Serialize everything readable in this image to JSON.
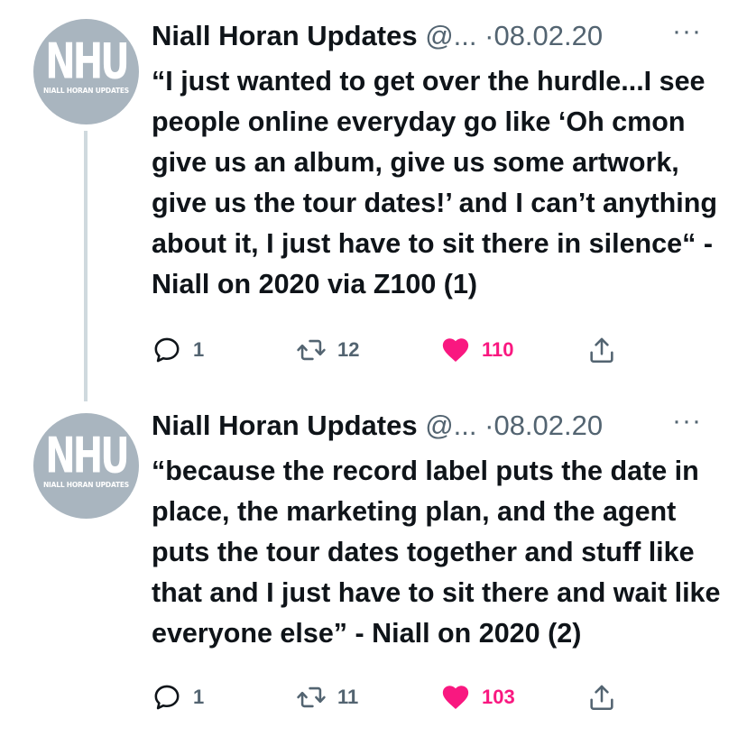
{
  "tweets": [
    {
      "avatar": {
        "logo": "NHU",
        "sub": "NIALL HORAN UPDATES"
      },
      "author_name": "Niall Horan Updates",
      "handle": "@...",
      "separator": "·",
      "date": "08.02.20",
      "more_label": "···",
      "text": "“I just wanted to get over the hurdle...I see people online everyday go like ‘Oh cmon give us an album, give us some artwork, give us the tour dates!’ and I can’t anything about it, I just have to sit there in silence“ - Niall on 2020 via Z100 (1)",
      "reply_count": "1",
      "retweet_count": "12",
      "like_count": "110",
      "liked": true
    },
    {
      "avatar": {
        "logo": "NHU",
        "sub": "NIALL HORAN UPDATES"
      },
      "author_name": "Niall Horan Updates",
      "handle": "@...",
      "separator": "·",
      "date": "08.02.20",
      "more_label": "···",
      "text": "“because the record label puts the date in place, the marketing plan, and the agent puts the tour dates together and stuff like that and I just have to sit there and wait like everyone else” - Niall on 2020 (2)",
      "reply_count": "1",
      "retweet_count": "11",
      "like_count": "103",
      "liked": true
    }
  ],
  "colors": {
    "like": "#f91880",
    "muted": "#536471",
    "text": "#0f1419",
    "avatar_bg": "#a9b5bf",
    "thread_line": "#cfd9de"
  },
  "icons": {
    "reply": "reply-icon",
    "retweet": "retweet-icon",
    "like": "heart-icon",
    "share": "share-icon"
  }
}
